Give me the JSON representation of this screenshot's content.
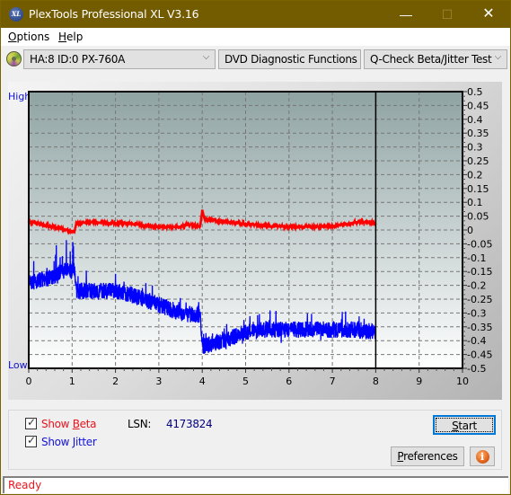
{
  "window": {
    "title": "PlexTools Professional XL V3.16",
    "app_icon": "xl-logo-icon",
    "controls": {
      "minimize": "—",
      "maximize": "☐",
      "close": "✕"
    }
  },
  "menu": [
    {
      "label": "Options",
      "accel": "O"
    },
    {
      "label": "Help",
      "accel": "H"
    }
  ],
  "toolbar": {
    "drive_icon": "disc-icon",
    "drive": "HA:8 ID:0  PX-760A",
    "function": "DVD Diagnostic Functions",
    "test": "Q-Check Beta/Jitter Test",
    "chevron": "⌵"
  },
  "chart": {
    "left_label_high": "High",
    "left_label_low": "Low"
  },
  "controls": {
    "show_beta": {
      "label": "Show Beta",
      "checked": true,
      "color": "#e8141e"
    },
    "show_jitter": {
      "label": "Show Jitter",
      "checked": true,
      "color": "#1414d8"
    },
    "lsn_label": "LSN:",
    "lsn_value": "4173824",
    "start_label": "Start",
    "preferences_label": "Preferences",
    "info_icon": "i"
  },
  "status": {
    "text": "Ready"
  },
  "chart_data": {
    "type": "line",
    "title": "",
    "xlabel": "",
    "ylabel": "",
    "xlim": [
      0,
      10
    ],
    "ylim": [
      -0.5,
      0.5
    ],
    "x_ticks": [
      "0",
      "1",
      "2",
      "3",
      "4",
      "5",
      "6",
      "7",
      "8",
      "9",
      "10"
    ],
    "y_ticks": [
      "0.5",
      "0.45",
      "0.4",
      "0.35",
      "0.3",
      "0.25",
      "0.2",
      "0.15",
      "0.1",
      "0.05",
      "0",
      "-0.05",
      "-0.1",
      "-0.15",
      "-0.2",
      "-0.25",
      "-0.3",
      "-0.35",
      "-0.4",
      "-0.45",
      "-0.5"
    ],
    "grid": true,
    "marker_x": 8.0,
    "background_gradient": [
      "#8fa3a3",
      "#ffffff"
    ],
    "series": [
      {
        "name": "Beta",
        "color": "#ff0000",
        "points": [
          [
            0,
            0.03
          ],
          [
            0.3,
            0.02
          ],
          [
            0.6,
            0.01
          ],
          [
            0.9,
            0.0
          ],
          [
            1.05,
            -0.005
          ],
          [
            1.1,
            0.025
          ],
          [
            1.5,
            0.028
          ],
          [
            2.0,
            0.025
          ],
          [
            2.5,
            0.02
          ],
          [
            3.0,
            0.01
          ],
          [
            3.5,
            0.012
          ],
          [
            3.7,
            0.02
          ],
          [
            3.95,
            0.013
          ],
          [
            4.0,
            0.07
          ],
          [
            4.05,
            0.04
          ],
          [
            4.5,
            0.03
          ],
          [
            5.0,
            0.022
          ],
          [
            5.5,
            0.015
          ],
          [
            6.0,
            0.012
          ],
          [
            6.5,
            0.012
          ],
          [
            7.0,
            0.013
          ],
          [
            7.3,
            0.02
          ],
          [
            7.6,
            0.03
          ],
          [
            7.95,
            0.028
          ],
          [
            8.0,
            0.018
          ]
        ],
        "noise": 0.004
      },
      {
        "name": "Jitter",
        "color": "#0000ff",
        "points": [
          [
            0,
            -0.19
          ],
          [
            0.3,
            -0.18
          ],
          [
            0.6,
            -0.17
          ],
          [
            0.9,
            -0.14
          ],
          [
            1.0,
            -0.15
          ],
          [
            1.05,
            -0.14
          ],
          [
            1.1,
            -0.22
          ],
          [
            1.5,
            -0.22
          ],
          [
            2.0,
            -0.22
          ],
          [
            2.5,
            -0.24
          ],
          [
            3.0,
            -0.27
          ],
          [
            3.5,
            -0.3
          ],
          [
            3.95,
            -0.31
          ],
          [
            4.0,
            -0.42
          ],
          [
            4.5,
            -0.4
          ],
          [
            5.0,
            -0.37
          ],
          [
            5.5,
            -0.36
          ],
          [
            6.0,
            -0.36
          ],
          [
            6.5,
            -0.36
          ],
          [
            7.0,
            -0.36
          ],
          [
            7.5,
            -0.36
          ],
          [
            8.0,
            -0.37
          ]
        ],
        "noise": 0.03,
        "spikes": [
          [
            0.95,
            -0.02
          ],
          [
            0.85,
            -0.05
          ],
          [
            1.0,
            -0.03
          ]
        ]
      }
    ]
  }
}
